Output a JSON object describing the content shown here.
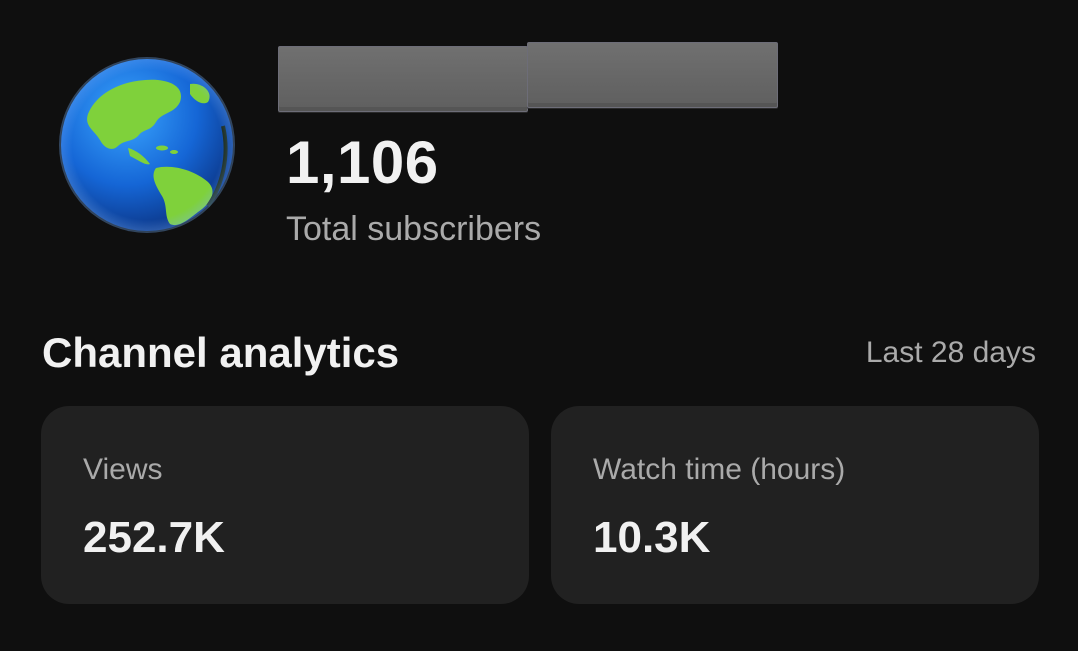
{
  "channel": {
    "avatar_icon": "globe-americas-icon",
    "name_redacted": true,
    "subscriber_count": "1,106",
    "subscriber_label": "Total subscribers"
  },
  "analytics": {
    "title": "Channel analytics",
    "period": "Last 28 days",
    "cards": [
      {
        "label": "Views",
        "value": "252.7K"
      },
      {
        "label": "Watch time (hours)",
        "value": "10.3K"
      }
    ]
  },
  "colors": {
    "background": "#0f0f0f",
    "card": "#212121",
    "primary_text": "#f1f1f1",
    "secondary_text": "#aaaaaa"
  }
}
